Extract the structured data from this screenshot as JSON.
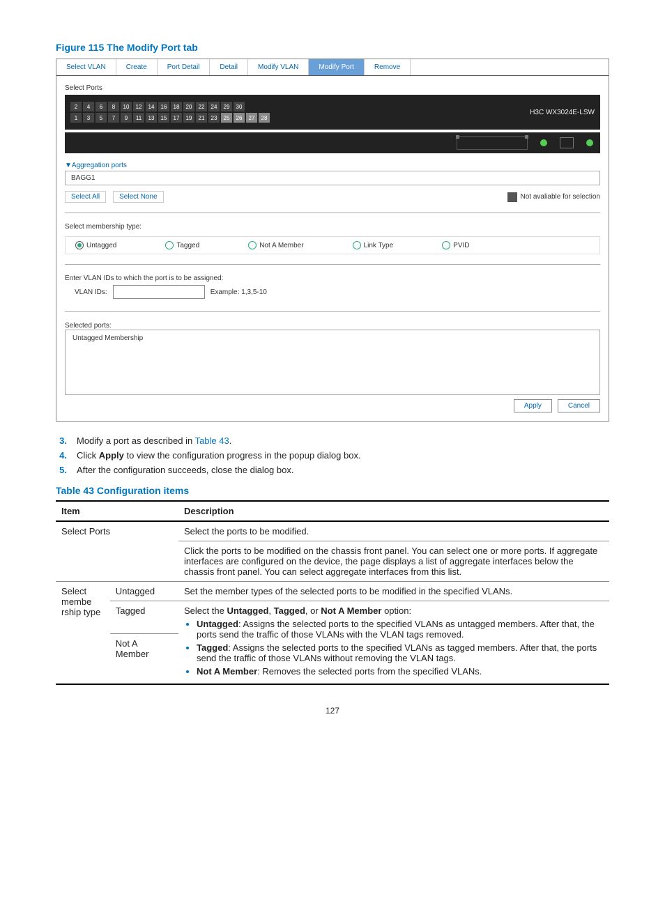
{
  "figure_title": "Figure 115 The Modify Port tab",
  "screenshot": {
    "tabs": [
      "Select VLAN",
      "Create",
      "Port Detail",
      "Detail",
      "Modify VLAN",
      "Modify Port",
      "Remove"
    ],
    "active_tab_index": 5,
    "select_ports_label": "Select Ports",
    "device_label": "H3C WX3024E-LSW",
    "ports_top": [
      "2",
      "4",
      "6",
      "8",
      "10",
      "12",
      "14",
      "16",
      "18",
      "20",
      "22",
      "24",
      "29",
      "30"
    ],
    "ports_bottom": [
      "1",
      "3",
      "5",
      "7",
      "9",
      "11",
      "13",
      "15",
      "17",
      "19",
      "21",
      "23",
      "25",
      "26",
      "27",
      "28"
    ],
    "agg_header": "Aggregation ports",
    "agg_item": "BAGG1",
    "select_all": "Select All",
    "select_none": "Select None",
    "legend_text": "Not avaliable for selection",
    "membership_label": "Select membership type:",
    "radios": [
      "Untagged",
      "Tagged",
      "Not A Member",
      "Link Type",
      "PVID"
    ],
    "radio_selected_index": 0,
    "enter_vlan_label": "Enter VLAN IDs to which the port is to be assigned:",
    "vlan_ids_label": "VLAN IDs:",
    "vlan_example": "Example: 1,3,5-10",
    "selected_ports_label": "Selected ports:",
    "untagged_membership": "Untagged Membership",
    "apply": "Apply",
    "cancel": "Cancel"
  },
  "steps": [
    {
      "n": "3.",
      "text_pre": "Modify a port as described in ",
      "link": "Table 43",
      "text_post": "."
    },
    {
      "n": "4.",
      "text_pre": "Click ",
      "bold": "Apply",
      "text_post": " to view the configuration progress in the popup dialog box."
    },
    {
      "n": "5.",
      "text_pre": "After the configuration succeeds, close the dialog box.",
      "bold": "",
      "text_post": ""
    }
  ],
  "table_title": "Table 43 Configuration items",
  "table": {
    "h_item": "Item",
    "h_desc": "Description",
    "r1_item": "Select Ports",
    "r1_d1": "Select the ports to be modified.",
    "r1_d2": "Click the ports to be modified on the chassis front panel. You can select one or more ports. If aggregate interfaces are configured on the device, the page displays a list of aggregate interfaces below the chassis front panel. You can select aggregate interfaces from this list.",
    "r2_item": "Select membe rship type",
    "r2_sub_untagged": "Untagged",
    "r2_sub_tagged": "Tagged",
    "r2_sub_notmember": "Not A Member",
    "r2_d_intro": "Set the member types of the selected ports to be modified in the specified VLANs.",
    "r2_d_select_pre": "Select the ",
    "r2_d_select_b1": "Untagged",
    "r2_d_select_mid1": ", ",
    "r2_d_select_b2": "Tagged",
    "r2_d_select_mid2": ", or ",
    "r2_d_select_b3": "Not A Member",
    "r2_d_select_post": " option:",
    "bul1_b": "Untagged",
    "bul1_t": ": Assigns the selected ports to the specified VLANs as untagged members. After that, the ports send the traffic of those VLANs with the VLAN tags removed.",
    "bul2_b": "Tagged",
    "bul2_t": ": Assigns the selected ports to the specified VLANs as tagged members. After that, the ports send the traffic of those VLANs without removing the VLAN tags.",
    "bul3_b": "Not A Member",
    "bul3_t": ": Removes the selected ports from the specified VLANs."
  },
  "page_number": "127"
}
